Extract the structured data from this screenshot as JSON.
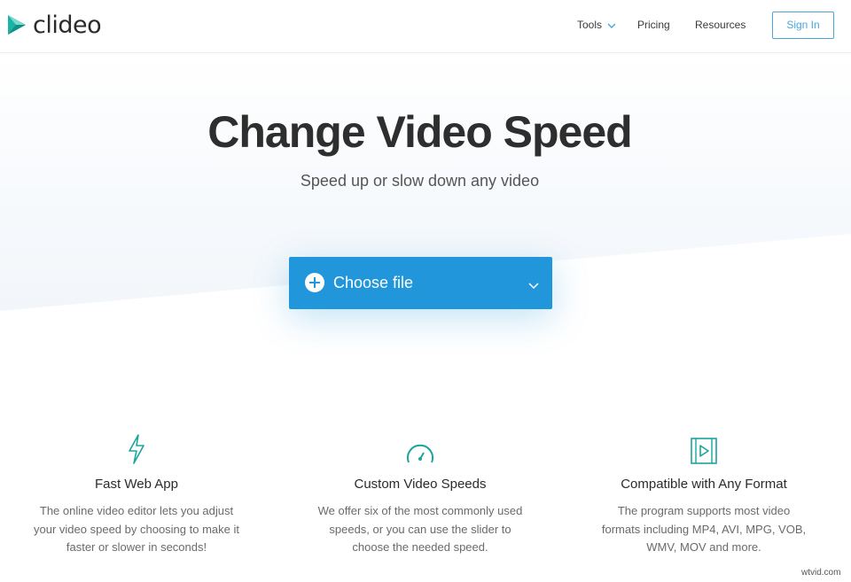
{
  "header": {
    "logo_text": "clideo",
    "nav": {
      "tools_label": "Tools",
      "pricing_label": "Pricing",
      "resources_label": "Resources"
    },
    "signin_label": "Sign In"
  },
  "hero": {
    "title": "Change Video Speed",
    "subtitle": "Speed up or slow down any video",
    "choose_file_label": "Choose file"
  },
  "features": [
    {
      "icon": "lightning-icon",
      "title": "Fast Web App",
      "description": "The online video editor lets you adjust your video speed by choosing to make it faster or slower in seconds!"
    },
    {
      "icon": "speedometer-icon",
      "title": "Custom Video Speeds",
      "description": "We offer six of the most commonly used speeds, or you can use the slider to choose the needed speed."
    },
    {
      "icon": "video-play-icon",
      "title": "Compatible with Any Format",
      "description": "The program supports most video formats including MP4, AVI, MPG, VOB, WMV, MOV and more."
    }
  ],
  "watermark": "wtvid.com",
  "colors": {
    "accent": "#2196db",
    "icon_teal": "#1aa5a0",
    "logo_teal": "#1ab3a6"
  }
}
